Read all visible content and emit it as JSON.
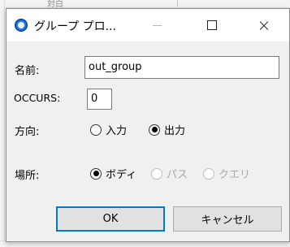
{
  "background": {
    "fragment_text": "対白"
  },
  "dialog": {
    "title": "グループ プロ...",
    "controls": {
      "minimize": "minimize",
      "maximize": "maximize",
      "close": "×"
    }
  },
  "form": {
    "name": {
      "label": "名前:",
      "value": "out_group"
    },
    "occurs": {
      "label": "OCCURS:",
      "value": "0"
    },
    "direction": {
      "label": "方向:",
      "options": [
        {
          "label": "入力",
          "selected": false,
          "enabled": true
        },
        {
          "label": "出力",
          "selected": true,
          "enabled": true
        }
      ]
    },
    "location": {
      "label": "場所:",
      "options": [
        {
          "label": "ボディ",
          "selected": true,
          "enabled": true
        },
        {
          "label": "パス",
          "selected": false,
          "enabled": false
        },
        {
          "label": "クエリ",
          "selected": false,
          "enabled": false
        }
      ]
    }
  },
  "buttons": {
    "ok": "OK",
    "cancel": "キャンセル"
  },
  "colors": {
    "focus_border": "#0078d7",
    "dialog_bg": "#f0f0f0",
    "disabled_text": "#a8a8a8"
  }
}
